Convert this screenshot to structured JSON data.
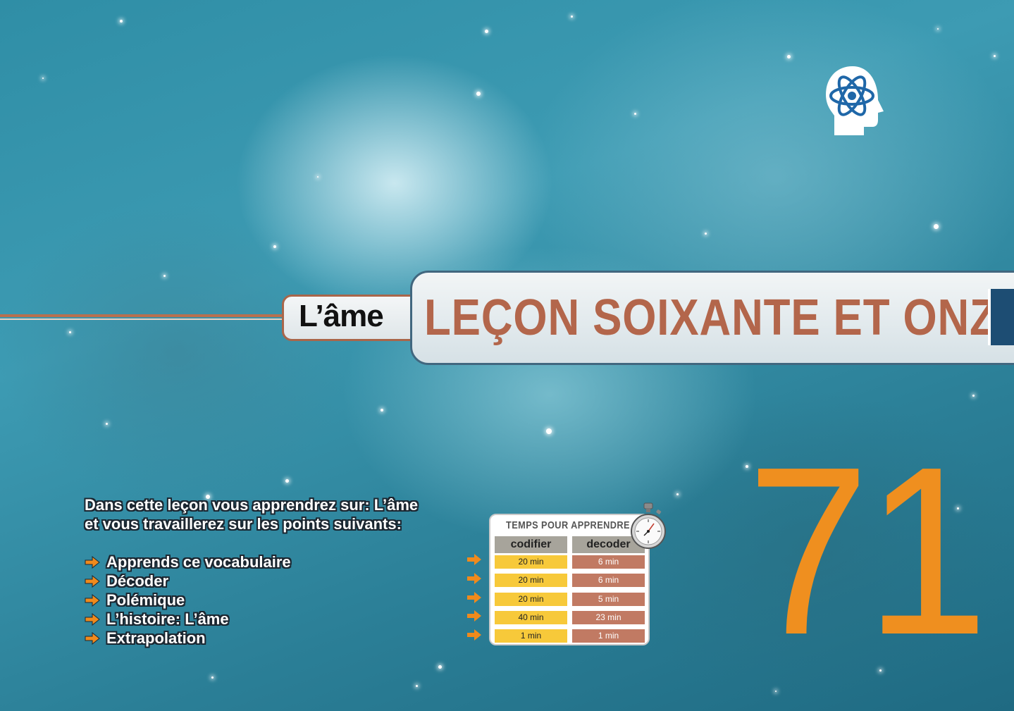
{
  "topic": "L’âme",
  "lesson_title": "LEÇON SOIXANTE ET ONZE",
  "lesson_number": "71",
  "intro": {
    "line1": "Dans cette leçon vous apprendrez sur: L’âme",
    "line2": "et vous travaillerez sur les points suivants:"
  },
  "points": [
    "Apprends ce vocabulaire",
    "Décoder",
    "Polémique",
    "L’histoire: L’âme",
    "Extrapolation"
  ],
  "timing": {
    "title": "TEMPS POUR APPRENDRE",
    "col_codifier": "codifier",
    "col_decoder": "decoder",
    "rows": [
      {
        "codifier": "20 min",
        "decoder": "6 min"
      },
      {
        "codifier": "20 min",
        "decoder": "6 min"
      },
      {
        "codifier": "20 min",
        "decoder": "5 min"
      },
      {
        "codifier": "40 min",
        "decoder": "23 min"
      },
      {
        "codifier": "1 min",
        "decoder": "1 min"
      }
    ]
  },
  "icons": {
    "logo": "head-atom-icon",
    "bullet": "arrow-right-icon",
    "timer": "stopwatch-icon"
  },
  "colors": {
    "title": "#b3664b",
    "number": "#ef8f1f",
    "codifier_cell": "#f7c93a",
    "decoder_cell": "#c17a63",
    "arrow": "#f08a1c"
  }
}
